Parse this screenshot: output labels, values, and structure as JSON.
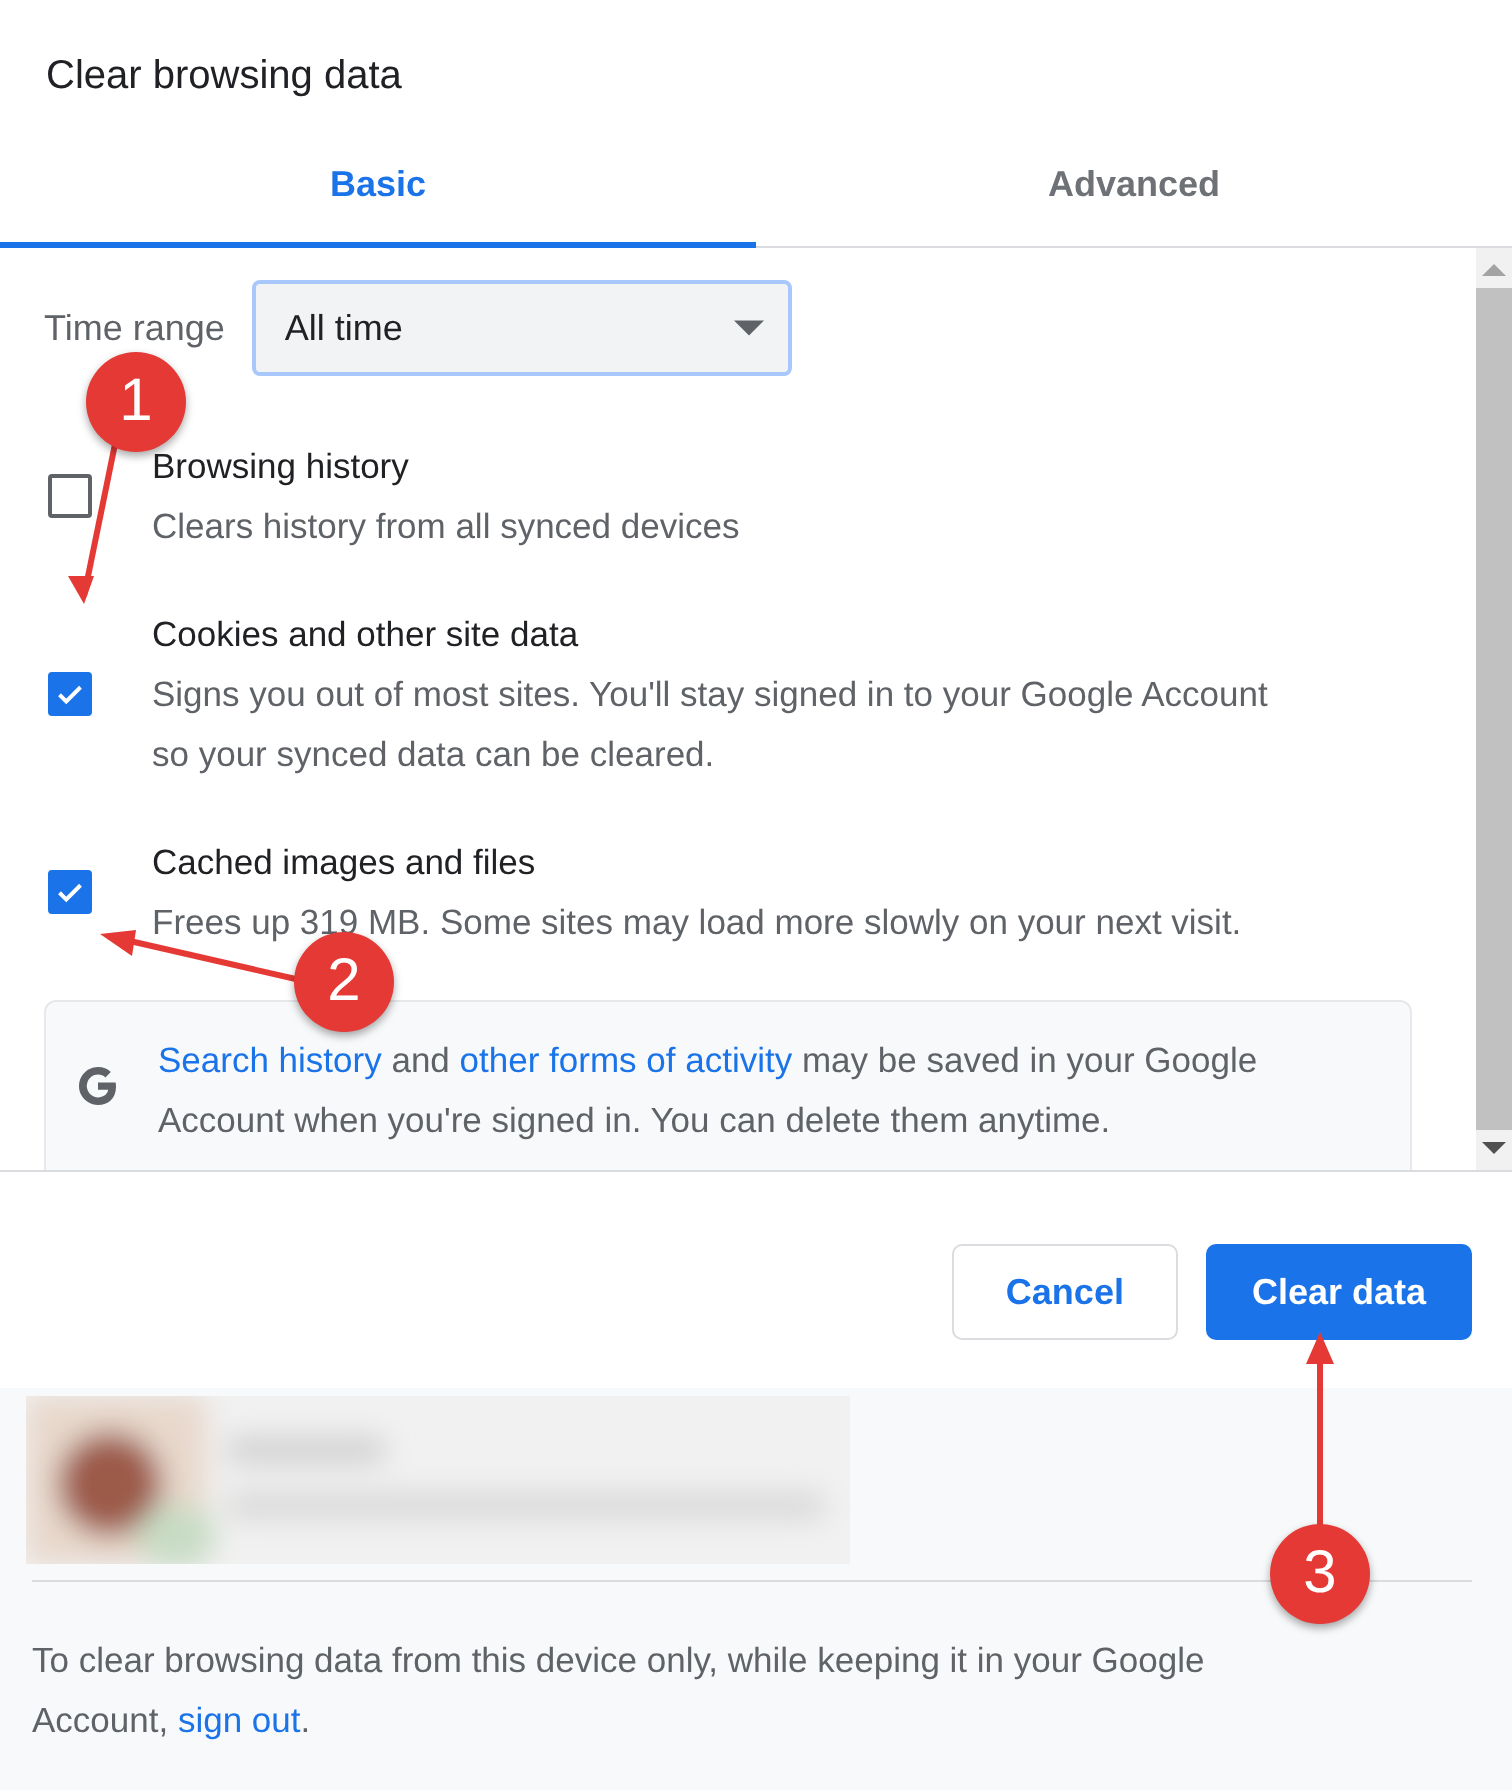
{
  "dialog": {
    "title": "Clear browsing data"
  },
  "tabs": [
    {
      "label": "Basic",
      "selected": true
    },
    {
      "label": "Advanced",
      "selected": false
    }
  ],
  "time_range": {
    "label": "Time range",
    "value": "All time"
  },
  "options": [
    {
      "title": "Browsing history",
      "description": "Clears history from all synced devices",
      "checked": false
    },
    {
      "title": "Cookies and other site data",
      "description": "Signs you out of most sites. You'll stay signed in to your Google Account so your synced data can be cleared.",
      "checked": true
    },
    {
      "title": "Cached images and files",
      "description": "Frees up 319 MB. Some sites may load more slowly on your next visit.",
      "checked": true
    }
  ],
  "info": {
    "segments": [
      {
        "text": "Search history",
        "link": true
      },
      {
        "text": " and ",
        "link": false
      },
      {
        "text": "other forms of activity",
        "link": true
      },
      {
        "text": " may be saved in your Google Account when you're signed in. You can delete them anytime.",
        "link": false
      }
    ]
  },
  "buttons": [
    {
      "label": "Cancel",
      "kind": "secondary"
    },
    {
      "label": "Clear data",
      "kind": "primary"
    }
  ],
  "footer": {
    "segments": [
      {
        "text": "To clear browsing data from this device only, while keeping it in your Google Account, ",
        "link": false
      },
      {
        "text": "sign out",
        "link": true
      },
      {
        "text": ".",
        "link": false
      }
    ]
  },
  "annotations": [
    {
      "label": "1"
    },
    {
      "label": "2"
    },
    {
      "label": "3"
    }
  ]
}
